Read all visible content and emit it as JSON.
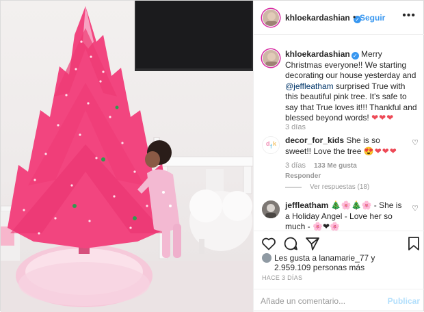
{
  "post": {
    "username": "khloekardashian",
    "follow_label": "Seguir",
    "separator": "•",
    "more_label": "•••",
    "verified_glyph": "✓"
  },
  "caption": {
    "username": "khloekardashian",
    "text_part1": " Merry Christmas everyone!! We starting decorating our house yesterday and ",
    "mention": "@jeffleatham",
    "text_part2": " surprised True with this beautiful pink tree. It's safe to say that True loves it!!! Thankful and blessed beyond words! ",
    "hearts": "❤❤❤",
    "time": "3 días"
  },
  "comments": [
    {
      "username": "decor_for_kids",
      "text": " She is so sweet!! Love the tree",
      "emoji": "😍❤❤❤",
      "time": "3 días",
      "likes": "133 Me gusta",
      "reply_label": "Responder",
      "view_replies": "Ver respuestas (18)",
      "avatar_text": "dfk"
    },
    {
      "username": "jeffleatham",
      "emoji_after_name": " 🎄🌸🎄🌸 - ",
      "text": "She is a Holiday Angel - Love her so much - ",
      "emoji_end": "🌸❤🌸"
    }
  ],
  "actions": {
    "like_icon": "heart-outline-icon",
    "comment_icon": "comment-icon",
    "share_icon": "share-icon",
    "save_icon": "bookmark-icon"
  },
  "likes_line1": "Les gusta a lanamarie_77 y",
  "likes_line2": "2.959.109 personas más",
  "posted_ago": "HACE 3 DÍAS",
  "comment_box": {
    "placeholder": "Añade un comentario...",
    "publish_label": "Publicar"
  },
  "colors": {
    "link_blue": "#3897f0",
    "heart_red": "#ed4956",
    "tree_pink": "#f2457f",
    "muted": "#999999"
  }
}
